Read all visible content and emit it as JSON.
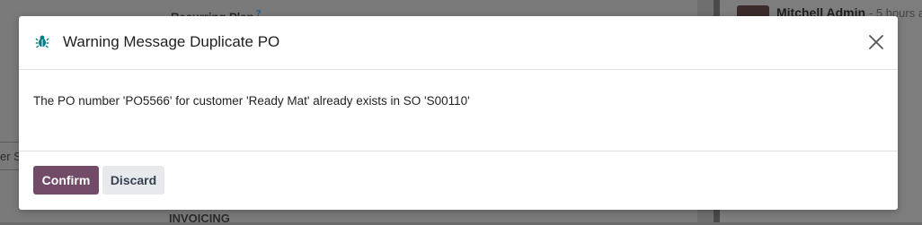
{
  "background": {
    "plan_label": "Recurring Plan",
    "plan_help": "?",
    "tab_fragment": "er S",
    "section_label": "INVOICING",
    "chatter_user": "Mitchell Admin",
    "chatter_time": "- 5 hours a"
  },
  "dialog": {
    "icon": "bug-icon",
    "title": "Warning Message Duplicate PO",
    "message": "The PO number 'PO5566' for customer 'Ready Mat' already exists in SO 'S00110'",
    "confirm_label": "Confirm",
    "discard_label": "Discard",
    "close_icon": "close-icon",
    "accent_color": "#714b67",
    "icon_color": "#017e84"
  }
}
